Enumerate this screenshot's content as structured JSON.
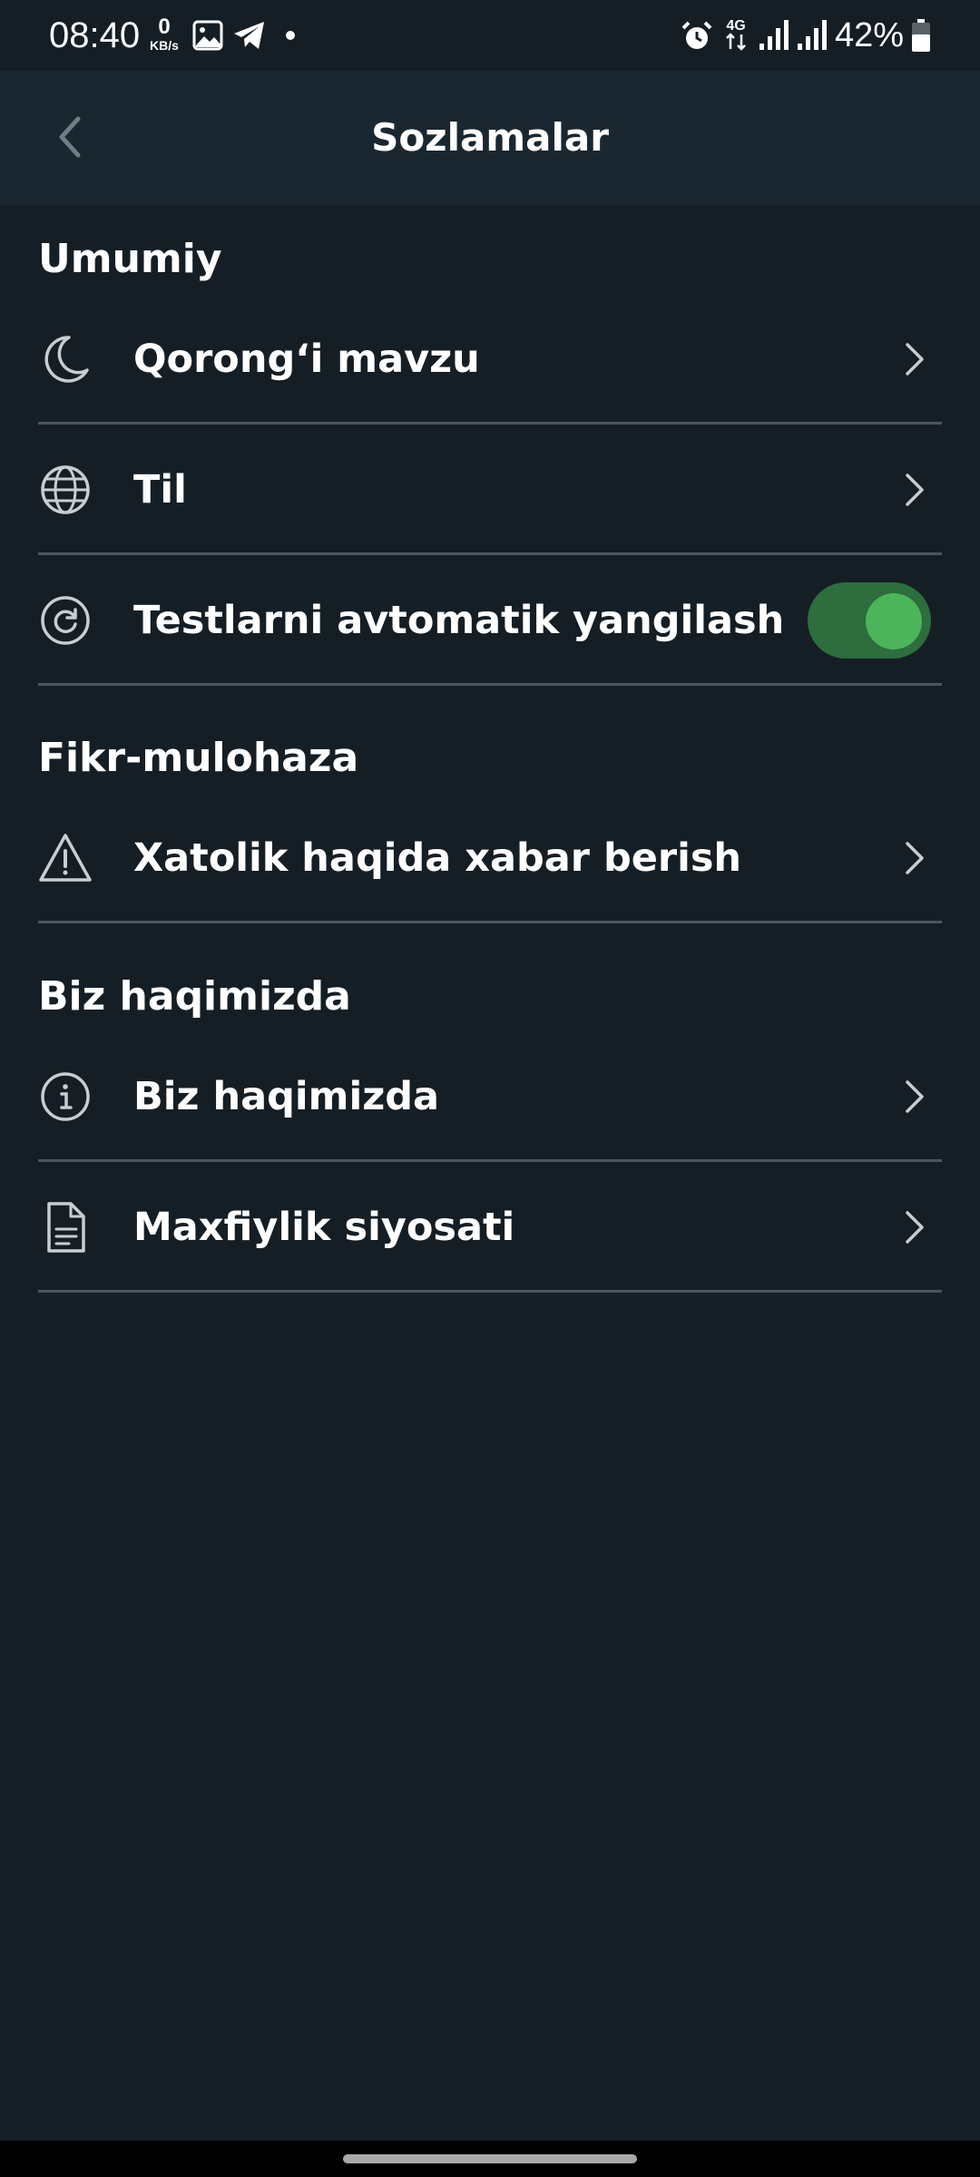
{
  "status_bar": {
    "time": "08:40",
    "net_speed_value": "0",
    "net_speed_unit": "KB/s",
    "battery": "42%",
    "icons": [
      "gallery-icon",
      "telegram-icon",
      "dot-icon",
      "alarm-icon",
      "4g-icon",
      "signal-icon",
      "signal-icon",
      "battery-icon"
    ]
  },
  "app_bar": {
    "title": "Sozlamalar",
    "back_icon": "chevron-left-icon"
  },
  "sections": [
    {
      "title": "Umumiy",
      "items": [
        {
          "label": "Qorong‘i mavzu",
          "icon": "moon-icon",
          "control": "chevron"
        },
        {
          "label": "Til",
          "icon": "globe-icon",
          "control": "chevron"
        },
        {
          "label": "Testlarni avtomatik yangilash",
          "icon": "refresh-icon",
          "control": "toggle",
          "toggle_on": true
        }
      ]
    },
    {
      "title": "Fikr-mulohaza",
      "items": [
        {
          "label": "Xatolik haqida xabar berish",
          "icon": "warning-icon",
          "control": "chevron"
        }
      ]
    },
    {
      "title": "Biz haqimizda",
      "items": [
        {
          "label": "Biz haqimizda",
          "icon": "info-icon",
          "control": "chevron"
        },
        {
          "label": "Maxfiylik siyosati",
          "icon": "document-icon",
          "control": "chevron"
        }
      ]
    }
  ],
  "colors": {
    "background": "#161e25",
    "app_bar": "#1b2730",
    "divider": "#4b555d",
    "toggle_track": "#2e6d3e",
    "toggle_knob": "#4cb45a"
  }
}
